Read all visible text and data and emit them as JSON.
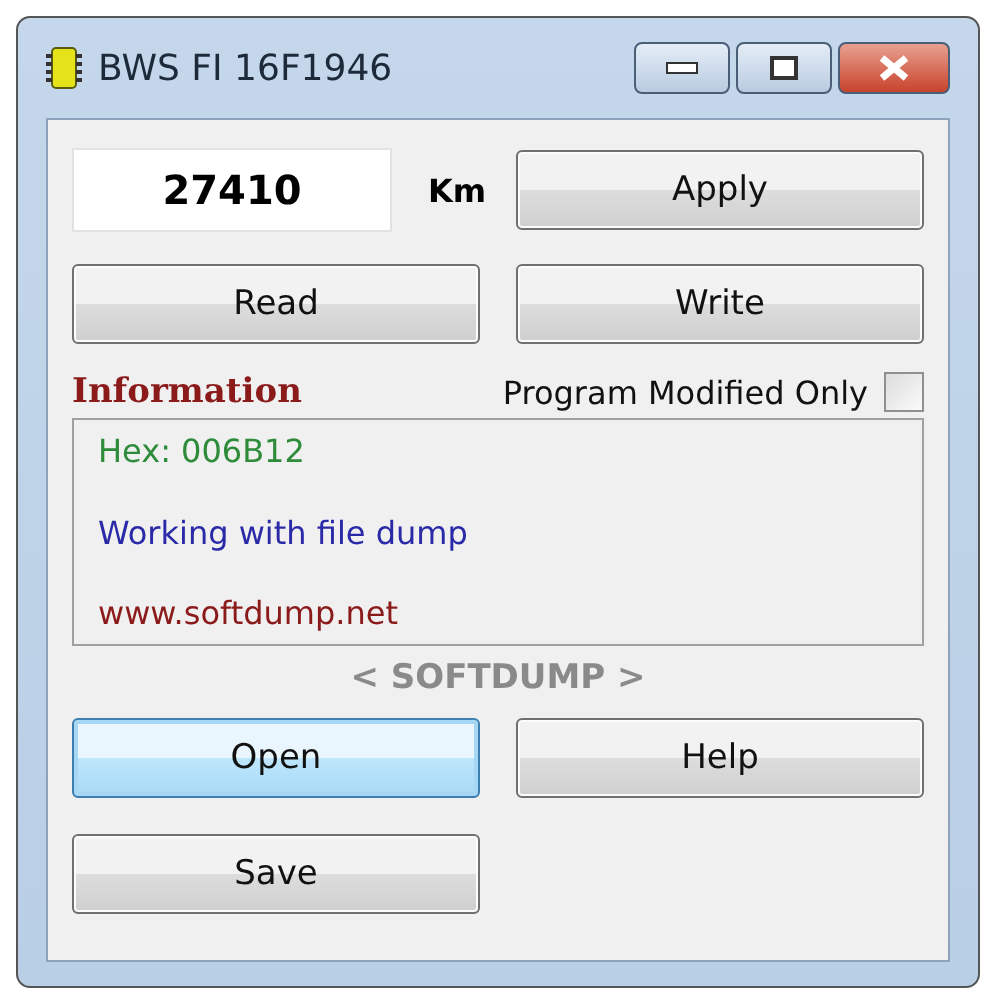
{
  "window": {
    "title": "BWS FI 16F1946"
  },
  "odometer": {
    "value": "27410",
    "unit": "Km"
  },
  "top_buttons": [
    {
      "label": "Apply",
      "focused": false
    },
    {
      "label": "Read",
      "focused": false
    },
    {
      "label": "Write",
      "focused": false
    }
  ],
  "information": {
    "title": "Information",
    "checkbox": {
      "label": "Program Modified Only",
      "checked": false
    },
    "lines": [
      {
        "text": "Hex: 006B12",
        "color": "#2e8b3a"
      },
      {
        "text": "Working with file dump",
        "color": "#2a2aa8"
      },
      {
        "text": "www.softdump.net",
        "color": "#8b1a1a"
      }
    ]
  },
  "brand": "< SOFTDUMP >",
  "bottom_buttons": [
    {
      "label": "Open",
      "focused": true
    },
    {
      "label": "Help",
      "focused": false
    },
    {
      "label": "Save",
      "focused": false
    }
  ]
}
